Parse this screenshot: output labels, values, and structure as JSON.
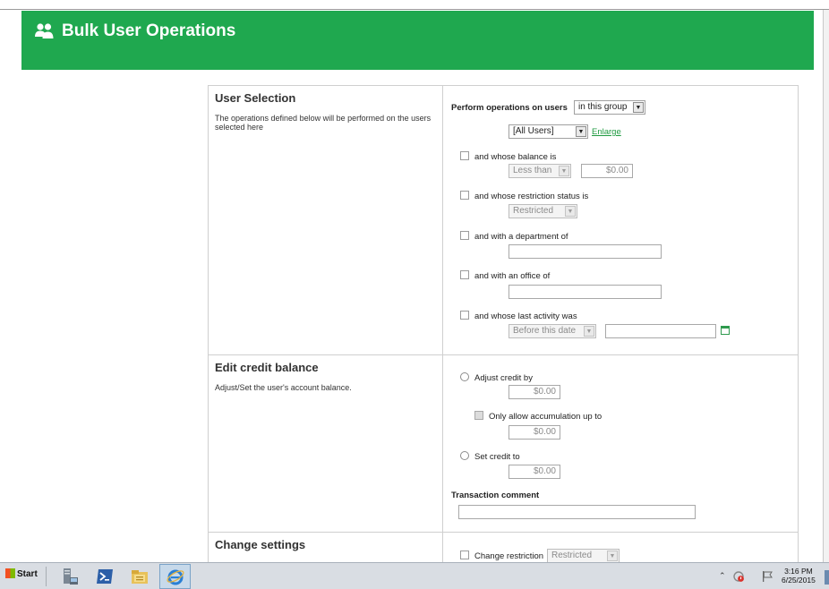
{
  "header": {
    "title": "Bulk User Operations",
    "icon": "users-icon"
  },
  "user_selection": {
    "title": "User Selection",
    "description": "The operations defined below will be performed on the users selected here",
    "perform_label": "Perform operations on users",
    "group_mode": "in this group",
    "group": "[All Users]",
    "enlarge": "Enlarge",
    "balance_label": "and whose balance is",
    "balance_operator": "Less than",
    "balance_value": "$0.00",
    "restriction_label": "and whose restriction status is",
    "restriction_value": "Restricted",
    "department_label": "and with a department of",
    "department_value": "",
    "office_label": "and with an office of",
    "office_value": "",
    "activity_label": "and whose last activity was",
    "activity_operator": "Before this date",
    "activity_date": ""
  },
  "edit_credit": {
    "title": "Edit credit balance",
    "description": "Adjust/Set the user's account balance.",
    "adjust_label": "Adjust credit by",
    "adjust_value": "$0.00",
    "accumulation_label": "Only allow accumulation up to",
    "accumulation_value": "$0.00",
    "set_label": "Set credit to",
    "set_value": "$0.00",
    "comment_label": "Transaction comment",
    "comment_value": ""
  },
  "change_settings": {
    "title": "Change settings",
    "change_restriction_label": "Change restriction",
    "change_restriction_value": "Restricted"
  },
  "taskbar": {
    "start_label": "Start",
    "time": "3:16 PM",
    "date": "6/25/2015"
  },
  "colors": {
    "brand_green": "#1fa84f",
    "link_green": "#1f9a40"
  }
}
